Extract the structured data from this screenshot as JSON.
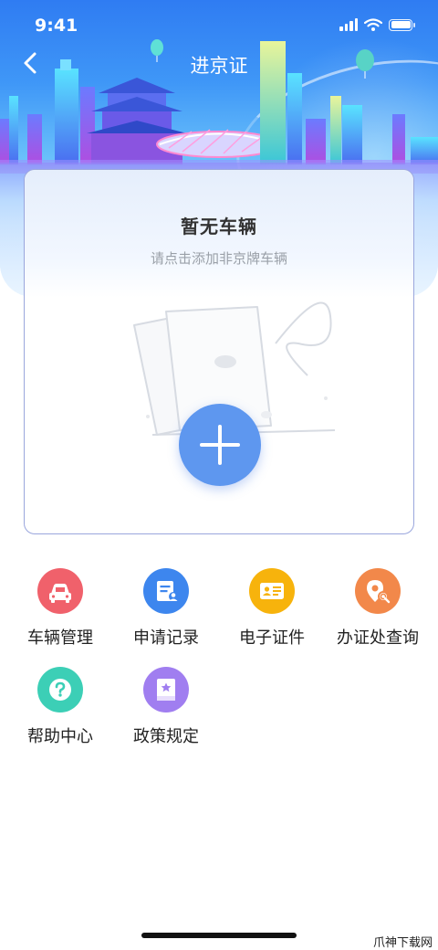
{
  "status_bar": {
    "time": "9:41"
  },
  "nav": {
    "title": "进京证"
  },
  "vehicle_card": {
    "title": "暂无车辆",
    "subtitle": "请点击添加非京牌车辆"
  },
  "menu": {
    "items": [
      {
        "label": "车辆管理",
        "icon": "car-icon",
        "color": "#f0616b"
      },
      {
        "label": "申请记录",
        "icon": "document-user-icon",
        "color": "#3d86ee"
      },
      {
        "label": "电子证件",
        "icon": "id-card-icon",
        "color": "#f7b30c"
      },
      {
        "label": "办证处查询",
        "icon": "location-search-icon",
        "color": "#f2884a"
      },
      {
        "label": "帮助中心",
        "icon": "help-icon",
        "color": "#3ccfb6"
      },
      {
        "label": "政策规定",
        "icon": "policy-book-icon",
        "color": "#a07ef0"
      }
    ]
  },
  "watermark": "爪神下载网",
  "colors": {
    "accent": "#5e97ef",
    "hero_top": "#2f7cf2"
  }
}
